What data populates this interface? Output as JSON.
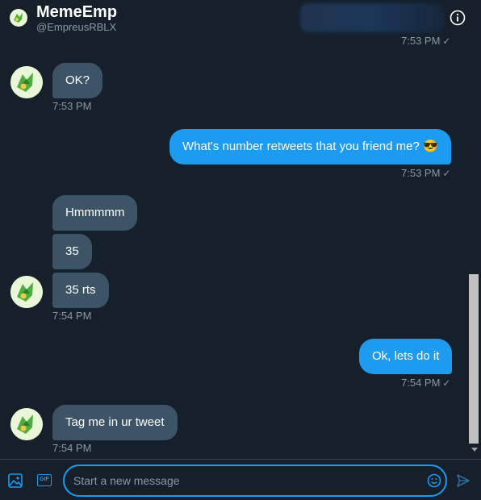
{
  "header": {
    "name": "MemeEmp",
    "handle": "@EmpreusRBLX"
  },
  "top_partial_time": "7:53 PM",
  "messages": [
    {
      "direction": "in",
      "text": "OK?",
      "time": "7:53 PM"
    },
    {
      "direction": "out",
      "text": "What's number retweets that you friend me? 😎",
      "time": "7:53 PM"
    },
    {
      "direction": "in",
      "text": "Hmmmmm"
    },
    {
      "direction": "in",
      "text": "35"
    },
    {
      "direction": "in",
      "text": "35 rts",
      "time": "7:54 PM"
    },
    {
      "direction": "out",
      "text": "Ok, lets do it",
      "time": "7:54 PM"
    },
    {
      "direction": "in",
      "text": "Tag me in ur tweet",
      "time": "7:54 PM"
    }
  ],
  "composer": {
    "placeholder": "Start a new message",
    "gif_label": "GIF"
  },
  "colors": {
    "background": "#15202b",
    "outgoing_bubble": "#1d9bf0",
    "incoming_bubble": "#3d5466",
    "secondary_text": "#8899a6"
  },
  "icons": [
    "info-icon",
    "image-icon",
    "gif-icon",
    "emoji-icon",
    "send-icon",
    "read-check-icon"
  ]
}
